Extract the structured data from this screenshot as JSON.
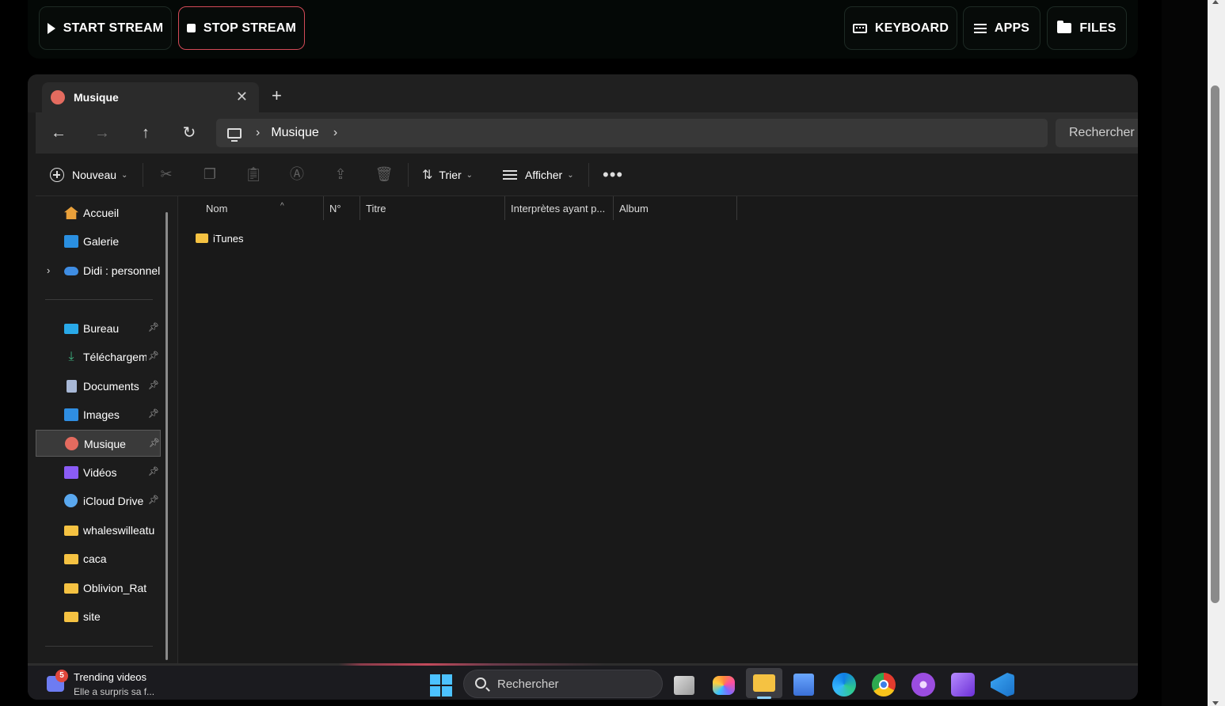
{
  "controls": {
    "start_stream": "START STREAM",
    "stop_stream": "STOP STREAM",
    "keyboard": "KEYBOARD",
    "apps": "APPS",
    "files": "FILES"
  },
  "explorer": {
    "tab_title": "Musique",
    "address_crumb": "Musique",
    "search_placeholder": "Rechercher dans : Musique",
    "toolbar": {
      "new_label": "Nouveau",
      "sort_label": "Trier",
      "view_label": "Afficher"
    },
    "nav": {
      "top": [
        {
          "label": "Accueil",
          "icon": "home-icon"
        },
        {
          "label": "Galerie",
          "icon": "gallery-icon"
        },
        {
          "label": "Didi : personnel",
          "icon": "onedrive-cloud-icon"
        }
      ],
      "pinned": [
        {
          "label": "Bureau",
          "icon": "desktop-icon",
          "pinned": true
        },
        {
          "label": "Téléchargements",
          "icon": "download-icon",
          "pinned": true
        },
        {
          "label": "Documents",
          "icon": "documents-icon",
          "pinned": true
        },
        {
          "label": "Images",
          "icon": "images-icon",
          "pinned": true
        },
        {
          "label": "Musique",
          "icon": "music-icon",
          "pinned": true,
          "selected": true
        },
        {
          "label": "Vidéos",
          "icon": "videos-icon",
          "pinned": true
        },
        {
          "label": "iCloud Drive",
          "icon": "icloud-icon",
          "pinned": true
        },
        {
          "label": "whaleswilleatu",
          "icon": "folder-icon"
        },
        {
          "label": "caca",
          "icon": "folder-icon"
        },
        {
          "label": "Oblivion_Rat",
          "icon": "folder-icon"
        },
        {
          "label": "site",
          "icon": "folder-icon"
        }
      ]
    },
    "columns": [
      "Nom",
      "N°",
      "Titre",
      "Interprètes ayant p...",
      "Album"
    ],
    "files": [
      {
        "name": "iTunes",
        "type": "folder"
      }
    ]
  },
  "taskbar": {
    "widget_badge": "5",
    "widget_title": "Trending videos",
    "widget_subtitle": "Elle a surpris sa f...",
    "search_label": "Rechercher",
    "apps": [
      "task-view-icon",
      "copilot-icon",
      "file-explorer-icon",
      "network-icon",
      "edge-icon",
      "chrome-icon",
      "tor-icon",
      "visual-studio-icon",
      "vscode-icon"
    ]
  },
  "colors": {
    "stop_border": "#d34a57",
    "folder": "#f5c242",
    "accent": "#4cc2ff"
  }
}
